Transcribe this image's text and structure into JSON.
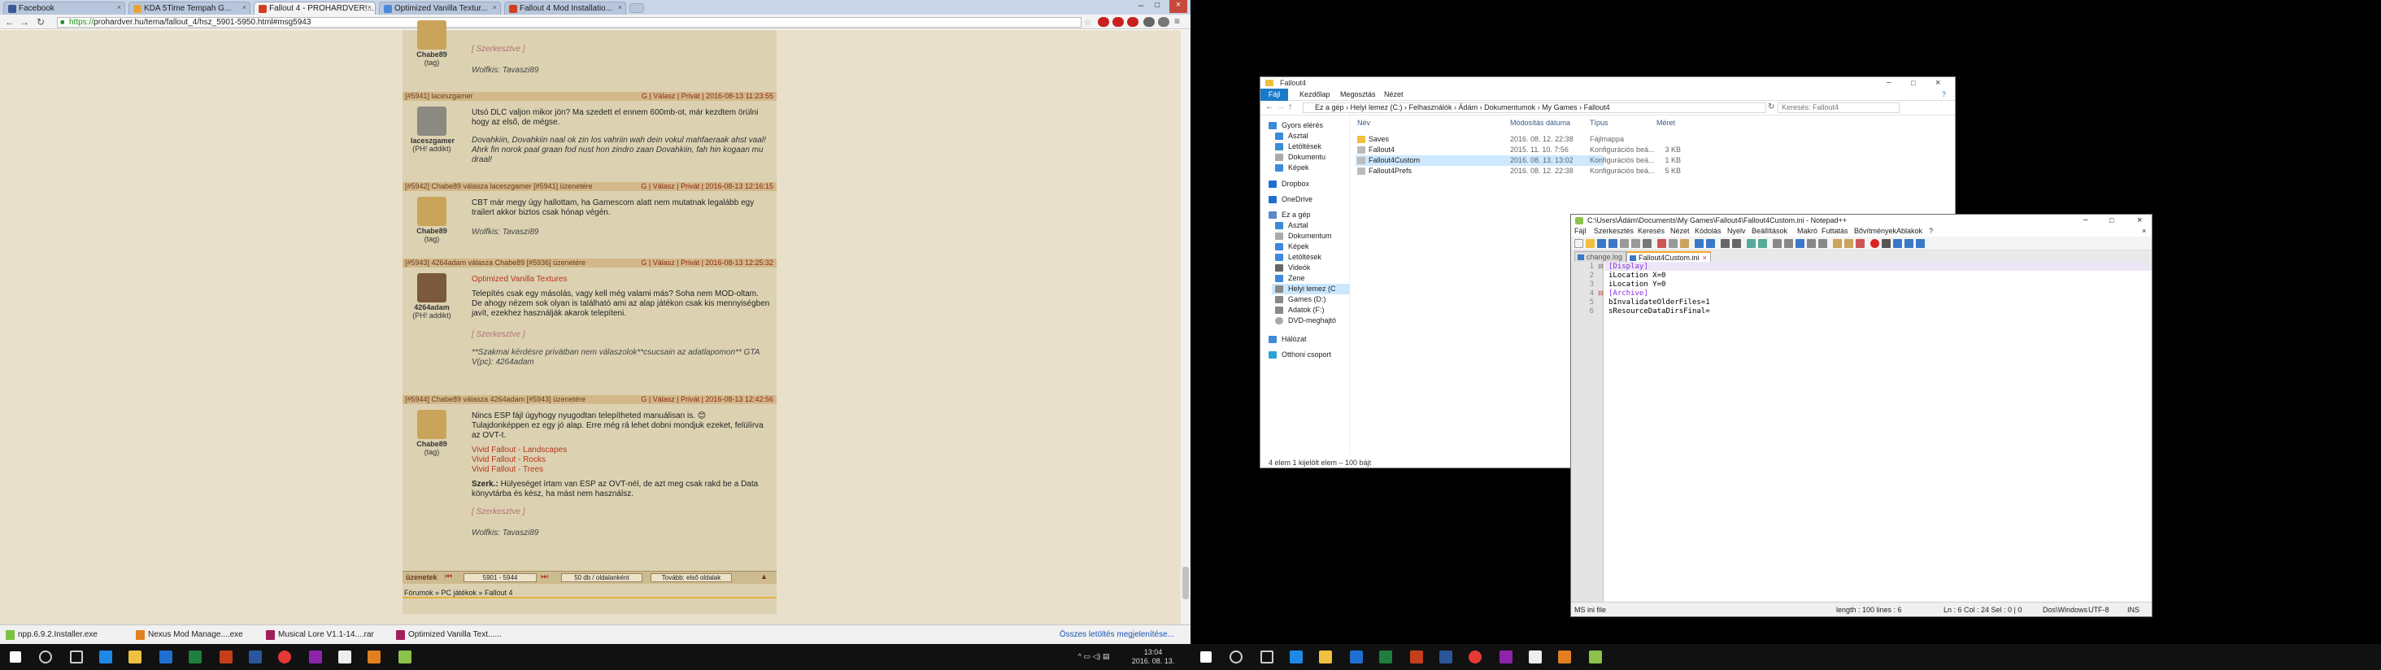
{
  "browser": {
    "tabs": [
      {
        "label": "Facebook",
        "color": "#3b5998"
      },
      {
        "label": "KDA 5Time Tempah G...",
        "color": "#e8a33b"
      },
      {
        "label": "Fallout 4 - PROHARDVER!...",
        "color": "#d04020"
      },
      {
        "label": "Optimized Vanilla Textur...",
        "color": "#4a8ad9"
      },
      {
        "label": "Fallout 4 Mod Installatio...",
        "color": "#d04020"
      }
    ],
    "url_scheme": "https://",
    "url_rest": "prohardver.hu/tema/fallout_4/hsz_5901-5950.html#msg5943",
    "downloads": [
      {
        "label": "npp.6.9.2.Installer.exe",
        "color": "#7ac143"
      },
      {
        "label": "Nexus Mod Manage....exe",
        "color": "#e08020"
      },
      {
        "label": "Musical Lore V1.1-14....rar",
        "color": "#a01f5a"
      },
      {
        "label": "Optimized Vanilla Text......",
        "color": "#a01f5a"
      }
    ],
    "show_all": "Összes letöltés megjelenítése..."
  },
  "forum": {
    "posts": [
      {
        "user": "Chabe89",
        "rank": "(tag)",
        "edit": "[ Szerkesztve ]",
        "sig": "Wolfkis: Tavaszi89"
      },
      {
        "header": "[#5941] laceszgamer",
        "meta": "G | Válasz | Privát | 2016-08-13 11:23:55",
        "user": "laceszgamer",
        "rank": "(PH! addikt)",
        "lines": [
          "Utsó DLC valjon mikor jön? Ma szedett el ennem 600mb-ot, már kezdtem örülni hogy az első, de mégse."
        ],
        "ital": "Dovahkiin, Dovahkiin naal ok zin los vahriin wah dein vokul mahfaeraak ahst vaal! Ahrk fin norok paal graan fod nust hon zindro zaan Dovahkiin, fah hin kogaan mu draal!"
      },
      {
        "header": "[#5942] Chabe89 válasza laceszgamer [#5941] üzenetére",
        "meta": "G | Válasz | Privát | 2016-08-13 12:16:15",
        "user": "Chabe89",
        "rank": "(tag)",
        "lines": [
          "CBT már megy úgy hallottam, ha Gamescom alatt nem mutatnak legalább egy trailert akkor biztos csak hónap végén."
        ],
        "sig": "Wolfkis: Tavaszi89"
      },
      {
        "header": "[#5943] 4264adam válasza Chabe89 [#5936] üzenetére",
        "meta": "G | Válasz | Privát | 2016-08-13 12:25:32",
        "user": "4264adam",
        "rank": "(PH! addikt)",
        "link": "Optimized Vanilla Textures",
        "lines": [
          "Telepítés csak egy másolás, vagy kell még valami más? Soha nem MOD-oltam. De ahogy nézem sok olyan is található ami az alap játékon csak kis mennyiségben javít, ezekhez használják akarok telepíteni."
        ],
        "edit": "[ Szerkesztve ]",
        "sig": "**Szakmai kérdésre privátban nem válaszolok**csucsain az adatlapomon** GTA V(pc): 4264adam"
      },
      {
        "header": "[#5944] Chabe89 válasza 4264adam [#5943] üzenetére",
        "meta": "G | Válasz | Privát | 2016-08-13 12:42:56",
        "user": "Chabe89",
        "rank": "(tag)",
        "lines": [
          "Nincs ESP fájl úgyhogy nyugodtan telepítheted manuálisan is. 😊",
          "Tulajdonképpen ez egy jó alap. Erre még rá lehet dobni mondjuk ezeket, felülírva az OVT-t."
        ],
        "links": [
          "Vivid Fallout - Landscapes",
          "Vivid Fallout - Rocks",
          "Vivid Fallout - Trees"
        ],
        "szerk_bold": "Szerk.:",
        "szerk": " Hülyeséget írtam van ESP az OVT-nél, de azt meg csak rakd be a Data könyvtárba és kész, ha mást nem használsz.",
        "edit": "[ Szerkesztve ]",
        "sig": "Wolfkis: Tavaszi89"
      }
    ],
    "pager": {
      "label": "üzenetek",
      "range": "5901 - 5944",
      "per_page": "50 db / oldalanként",
      "sort": "Tovább: első oldalak"
    },
    "breadcrumb": "Fórumok  »  PC játékok  »  Fallout 4"
  },
  "explorer": {
    "title": "Fallout4",
    "ribbon": [
      "Fájl",
      "Kezdőlap",
      "Megosztás",
      "Nézet"
    ],
    "path": "Ez a gép  ›  Helyi lemez (C:)  ›  Felhasználók  ›  Ádám  ›  Dokumentumok  ›  My Games  ›  Fallout4",
    "search_placeholder": "Keresés: Fallout4",
    "nav": [
      "Gyors elérés",
      "Asztal",
      "Letöltések",
      "Dokumentu",
      "Képek",
      "Dropbox",
      "OneDrive",
      "Ez a gép",
      "Asztal",
      "Dokumentum",
      "Képek",
      "Letöltések",
      "Videók",
      "Zene",
      "Helyi lemez (C",
      "Games (D:)",
      "Adatok (F:)",
      "DVD-meghajtó",
      "Hálózat",
      "Otthoni csoport"
    ],
    "columns": [
      "Név",
      "Módosítás dátuma",
      "Típus",
      "Méret"
    ],
    "files": [
      {
        "name": "Saves",
        "date": "2016. 08. 12. 22:38",
        "type": "Fájlmappa",
        "size": "",
        "kind": "folder"
      },
      {
        "name": "Fallout4",
        "date": "2015. 11. 10. 7:56",
        "type": "Konfigurációs beá...",
        "size": "3 KB",
        "kind": "ini"
      },
      {
        "name": "Fallout4Custom",
        "date": "2016. 08. 13. 13:02",
        "type": "Konfigurációs beá...",
        "size": "1 KB",
        "kind": "ini"
      },
      {
        "name": "Fallout4Prefs",
        "date": "2016. 08. 12. 22:38",
        "type": "Konfigurációs beá...",
        "size": "5 KB",
        "kind": "ini"
      }
    ],
    "status": "4 elem      1 kijelölt elem – 100 bájt"
  },
  "npp": {
    "title": "C:\\Users\\Ádám\\Documents\\My Games\\Fallout4\\Fallout4Custom.ini - Notepad++",
    "menu": [
      "Fájl",
      "Szerkesztés",
      "Keresés",
      "Nézet",
      "Kódolás",
      "Nyelv",
      "Beállítások",
      "Makró",
      "Futtatás",
      "Bővítmények",
      "Ablakok",
      "?"
    ],
    "tabs": [
      "change.log",
      "Fallout4Custom.ini"
    ],
    "lines": [
      "[Display]",
      "iLocation X=0",
      "iLocation Y=0",
      "[Archive]",
      "bInvalidateOlderFiles=1",
      "sResourceDataDirsFinal="
    ],
    "status": {
      "type": "MS ini file",
      "length": "length : 100    lines : 6",
      "pos": "Ln : 6    Col : 24    Sel : 0 | 0",
      "eol": "Dos\\Windows",
      "enc": "UTF-8",
      "ins": "INS"
    }
  },
  "taskbar": {
    "clock_time": "13:04",
    "clock_date": "2016. 08. 13."
  },
  "colors": {
    "forum_bg": "#dcd2b2",
    "forum_header": "#d3b889",
    "link_red": "#b5351c",
    "explorer_blue": "#1979ca"
  }
}
